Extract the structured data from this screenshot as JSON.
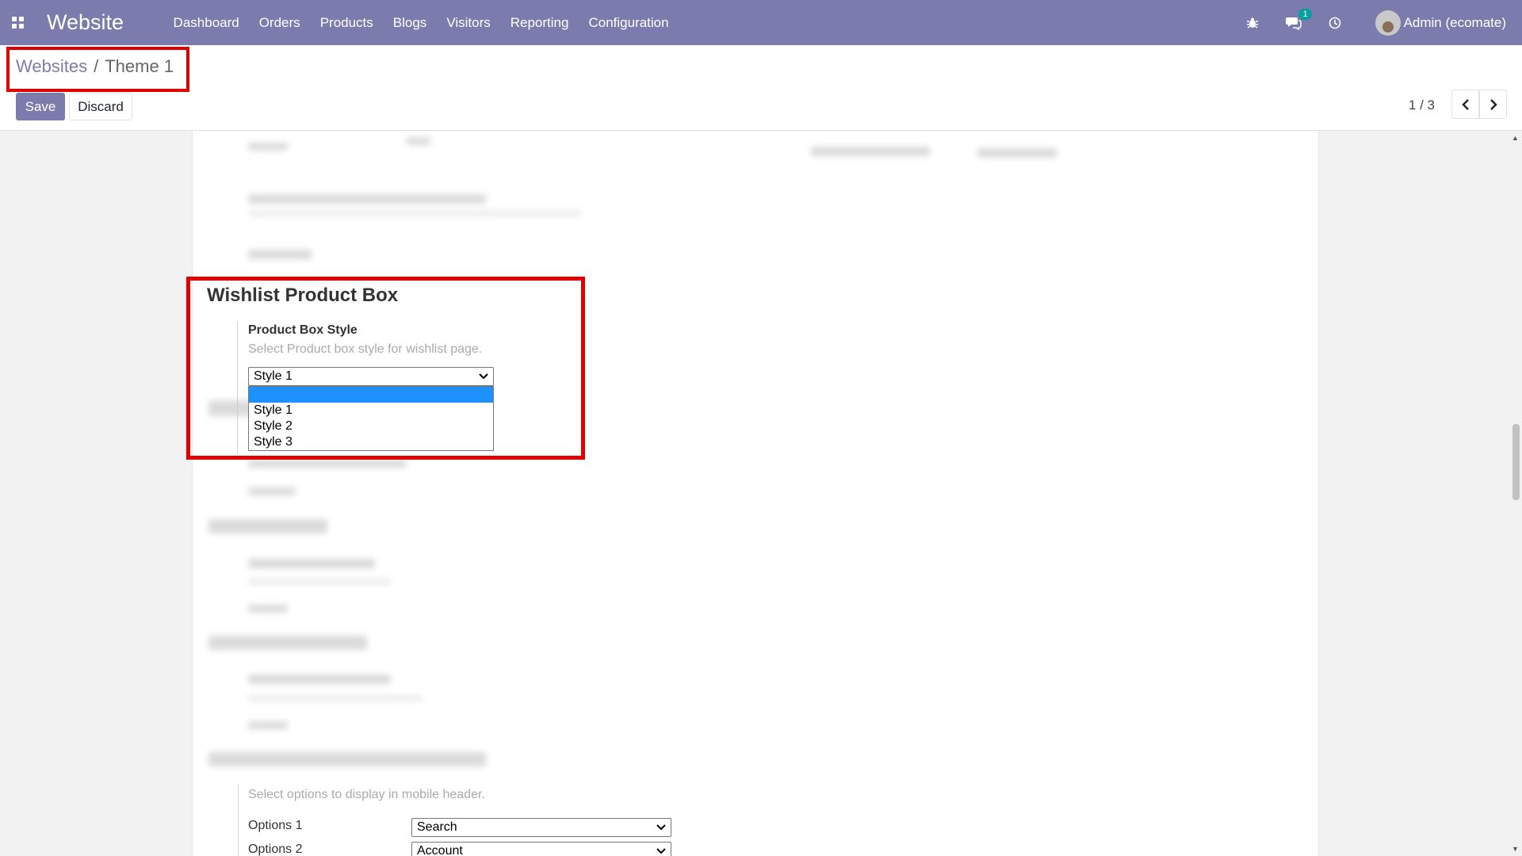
{
  "navbar": {
    "brand": "Website",
    "menu": [
      "Dashboard",
      "Orders",
      "Products",
      "Blogs",
      "Visitors",
      "Reporting",
      "Configuration"
    ],
    "chat_badge": "1",
    "user": "Admin (ecomate)"
  },
  "breadcrumb": {
    "parent": "Websites",
    "sep": "/",
    "current": "Theme 1"
  },
  "buttons": {
    "save": "Save",
    "discard": "Discard"
  },
  "pager": {
    "value": "1 / 3"
  },
  "wishlist_section": {
    "title": "Wishlist Product Box",
    "field_label": "Product Box Style",
    "field_help": "Select Product box style for wishlist page.",
    "selected": "Style 1",
    "options": [
      "Style 1",
      "Style 2",
      "Style 3"
    ]
  },
  "mobile_header": {
    "help": "Select options to display in mobile header.",
    "option1_label": "Options 1",
    "option1_value": "Search",
    "option2_label": "Options 2",
    "option2_value": "Account"
  },
  "colors": {
    "navbar": "#7c7bad",
    "highlight_border": "#e00000",
    "dropdown_selected": "#1e90ff"
  }
}
